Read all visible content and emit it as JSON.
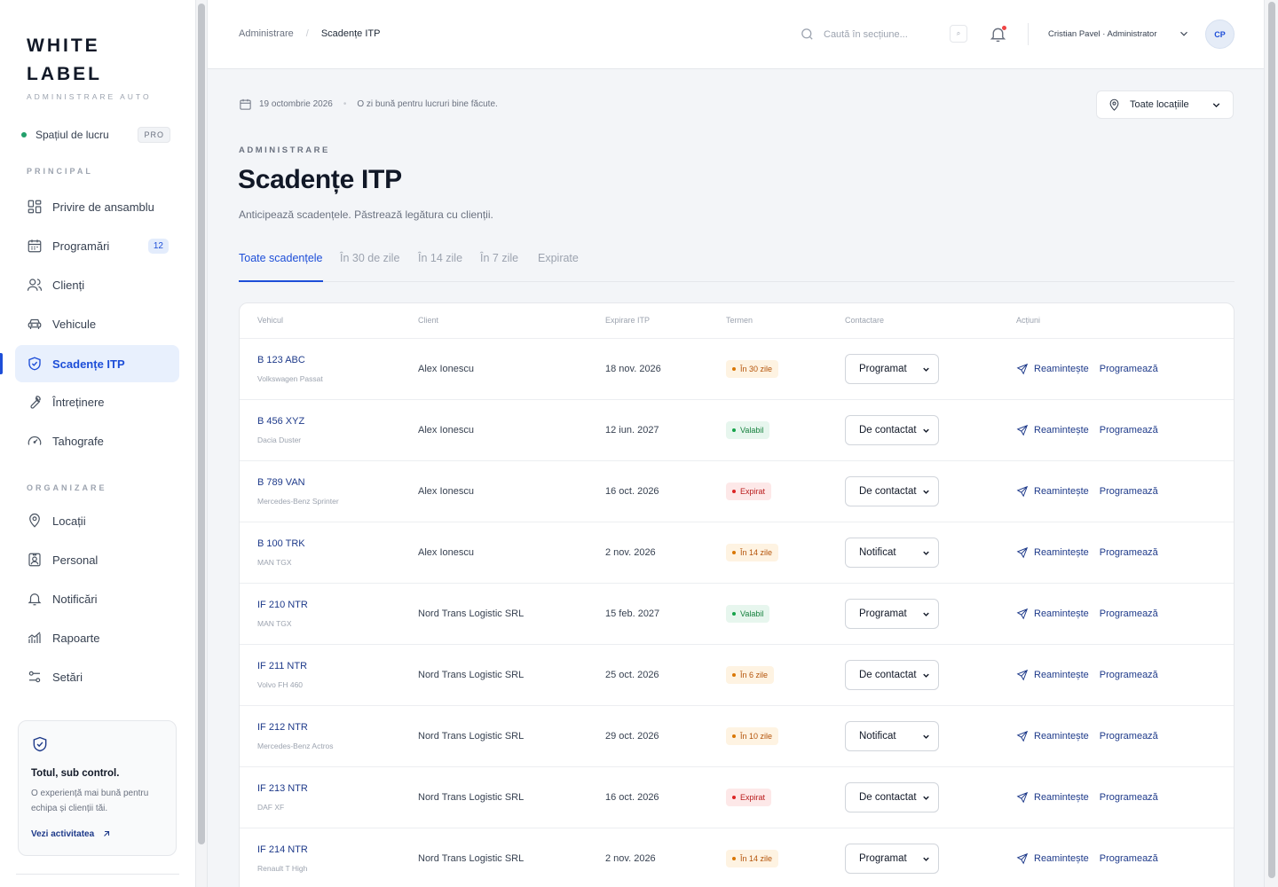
{
  "brand": {
    "title": "WHITE LABEL",
    "subtitle": "ADMINISTRARE AUTO"
  },
  "workspace": {
    "label": "Spațiul de lucru",
    "plan": "PRO"
  },
  "sidebar": {
    "section_main": "PRINCIPAL",
    "section_org": "ORGANIZARE",
    "items": [
      {
        "label": "Privire de ansamblu",
        "icon": "grid-icon"
      },
      {
        "label": "Programări",
        "icon": "calendar-icon",
        "badge": "12"
      },
      {
        "label": "Clienți",
        "icon": "users-icon"
      },
      {
        "label": "Vehicule",
        "icon": "car-icon"
      },
      {
        "label": "Scadențe ITP",
        "icon": "shield-check-icon",
        "active": true
      },
      {
        "label": "Întreținere",
        "icon": "wrench-icon"
      },
      {
        "label": "Tahografe",
        "icon": "gauge-icon"
      },
      {
        "label": "Locații",
        "icon": "map-pin-icon"
      },
      {
        "label": "Personal",
        "icon": "id-badge-icon"
      },
      {
        "label": "Notificări",
        "icon": "bell-icon"
      },
      {
        "label": "Rapoarte",
        "icon": "chart-icon"
      },
      {
        "label": "Setări",
        "icon": "sliders-icon"
      }
    ],
    "promo": {
      "title": "Totul, sub control.",
      "text": "O experiență mai bună pentru echipa și clienții tăi.",
      "link": "Vezi activitatea"
    }
  },
  "header": {
    "breadcrumb": [
      "Administrare",
      "Scadențe ITP"
    ],
    "search_placeholder": "Caută în secțiune...",
    "kbd": "⌕",
    "user": "Cristian Pavel · Administrator",
    "avatar": "CP"
  },
  "page": {
    "date": "19 octombrie 2026",
    "greeting": "O zi bună pentru lucruri bine făcute.",
    "location": "Toate locațiile",
    "eyebrow": "ADMINISTRARE",
    "title": "Scadențe ITP",
    "subtitle": "Anticipează scadențele. Păstrează legătura cu clienții.",
    "tabs": [
      "Toate scadențele",
      "În 30 de zile",
      "În 14 zile",
      "În 7 zile",
      "Expirate"
    ]
  },
  "table": {
    "headers": [
      "Vehicul",
      "Client",
      "Expirare ITP",
      "Termen",
      "Contactare",
      "Acțiuni"
    ],
    "remind_label": "Reamintește",
    "schedule_label": "Programează",
    "rows": [
      {
        "plate": "B 123 ABC",
        "model": "Volkswagen Passat",
        "client": "Alex Ionescu",
        "expiry": "18 nov. 2026",
        "term": "În 30 zile",
        "status": "warn",
        "contact": "Programat"
      },
      {
        "plate": "B 456 XYZ",
        "model": "Dacia Duster",
        "client": "Alex Ionescu",
        "expiry": "12 iun. 2027",
        "term": "Valabil",
        "status": "ok",
        "contact": "De contactat"
      },
      {
        "plate": "B 789 VAN",
        "model": "Mercedes-Benz Sprinter",
        "client": "Alex Ionescu",
        "expiry": "16 oct. 2026",
        "term": "Expirat",
        "status": "expired",
        "contact": "De contactat"
      },
      {
        "plate": "B 100 TRK",
        "model": "MAN TGX",
        "client": "Alex Ionescu",
        "expiry": "2 nov. 2026",
        "term": "În 14 zile",
        "status": "warn",
        "contact": "Notificat"
      },
      {
        "plate": "IF 210 NTR",
        "model": "MAN TGX",
        "client": "Nord Trans Logistic SRL",
        "expiry": "15 feb. 2027",
        "term": "Valabil",
        "status": "ok",
        "contact": "Programat"
      },
      {
        "plate": "IF 211 NTR",
        "model": "Volvo FH 460",
        "client": "Nord Trans Logistic SRL",
        "expiry": "25 oct. 2026",
        "term": "În 6 zile",
        "status": "warn",
        "contact": "De contactat"
      },
      {
        "plate": "IF 212 NTR",
        "model": "Mercedes-Benz Actros",
        "client": "Nord Trans Logistic SRL",
        "expiry": "29 oct. 2026",
        "term": "În 10 zile",
        "status": "warn",
        "contact": "Notificat"
      },
      {
        "plate": "IF 213 NTR",
        "model": "DAF XF",
        "client": "Nord Trans Logistic SRL",
        "expiry": "16 oct. 2026",
        "term": "Expirat",
        "status": "expired",
        "contact": "De contactat"
      },
      {
        "plate": "IF 214 NTR",
        "model": "Renault T High",
        "client": "Nord Trans Logistic SRL",
        "expiry": "2 nov. 2026",
        "term": "În 14 zile",
        "status": "warn",
        "contact": "Programat"
      }
    ]
  },
  "colors": {
    "accent": "#1d4ed8",
    "warn": "#d97706",
    "ok": "#16a34a",
    "expired": "#dc2626"
  }
}
